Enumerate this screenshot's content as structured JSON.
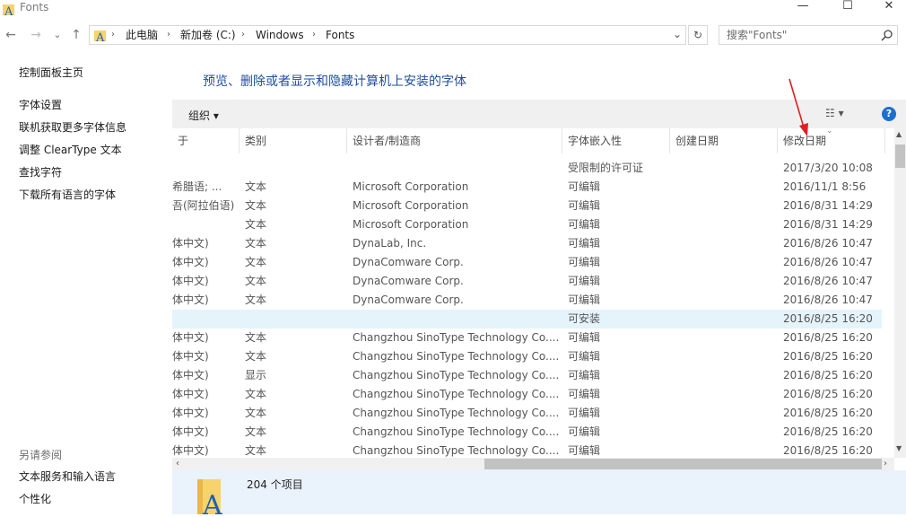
{
  "window": {
    "title": "Fonts",
    "controls": {
      "minimize": "—",
      "maximize": "☐",
      "close": "✕"
    }
  },
  "nav": {
    "back": "←",
    "forward": "→",
    "recent": "⌄",
    "up": "↑",
    "breadcrumbs": [
      "此电脑",
      "新加卷 (C:)",
      "Windows",
      "Fonts"
    ],
    "separator": "›",
    "dropdown": "⌄",
    "refresh": "↻",
    "search_placeholder": "搜索\"Fonts\"",
    "search_icon": "search-icon"
  },
  "left_pane": {
    "home": "控制面板主页",
    "links": [
      "字体设置",
      "联机获取更多字体信息",
      "调整 ClearType 文本",
      "查找字符",
      "下载所有语言的字体"
    ],
    "see_also_title": "另请参阅",
    "see_also": [
      "文本服务和输入语言",
      "个性化"
    ]
  },
  "main": {
    "heading": "预览、删除或者显示和隐藏计算机上安装的字体",
    "toolbar": {
      "organize": "组织 ▾",
      "view": "☷ ▾",
      "help": "?"
    },
    "columns": [
      "于",
      "类别",
      "设计者/制造商",
      "字体嵌入性",
      "创建日期",
      "修改日期"
    ],
    "rows": [
      {
        "lang": "",
        "category": "",
        "designer": "",
        "embed": "受限制的许可证",
        "created": "",
        "modified": "2017/3/20 10:08"
      },
      {
        "lang": "希腊语; ...",
        "category": "文本",
        "designer": "Microsoft Corporation",
        "embed": "可编辑",
        "created": "",
        "modified": "2016/11/1 8:56"
      },
      {
        "lang": "吾(阿拉伯语)",
        "category": "文本",
        "designer": "Microsoft Corporation",
        "embed": "可编辑",
        "created": "",
        "modified": "2016/8/31 14:29"
      },
      {
        "lang": "",
        "category": "文本",
        "designer": "Microsoft Corporation",
        "embed": "可编辑",
        "created": "",
        "modified": "2016/8/31 14:29"
      },
      {
        "lang": "体中文)",
        "category": "文本",
        "designer": "DynaLab, Inc.",
        "embed": "可编辑",
        "created": "",
        "modified": "2016/8/26 10:47"
      },
      {
        "lang": "体中文)",
        "category": "文本",
        "designer": "DynaComware Corp.",
        "embed": "可编辑",
        "created": "",
        "modified": "2016/8/26 10:47"
      },
      {
        "lang": "体中文)",
        "category": "文本",
        "designer": "DynaComware Corp.",
        "embed": "可编辑",
        "created": "",
        "modified": "2016/8/26 10:47"
      },
      {
        "lang": "体中文)",
        "category": "文本",
        "designer": "DynaComware Corp.",
        "embed": "可编辑",
        "created": "",
        "modified": "2016/8/26 10:47"
      },
      {
        "lang": "",
        "category": "",
        "designer": "",
        "embed": "可安装",
        "created": "",
        "modified": "2016/8/25 16:20",
        "selected": true
      },
      {
        "lang": "体中文)",
        "category": "文本",
        "designer": "Changzhou SinoType Technology Co....",
        "embed": "可编辑",
        "created": "",
        "modified": "2016/8/25 16:20"
      },
      {
        "lang": "体中文)",
        "category": "文本",
        "designer": "Changzhou SinoType Technology Co....",
        "embed": "可编辑",
        "created": "",
        "modified": "2016/8/25 16:20"
      },
      {
        "lang": "体中文)",
        "category": "显示",
        "designer": "Changzhou SinoType Technology Co....",
        "embed": "可编辑",
        "created": "",
        "modified": "2016/8/25 16:20"
      },
      {
        "lang": "体中文)",
        "category": "文本",
        "designer": "Changzhou SinoType Technology Co....",
        "embed": "可编辑",
        "created": "",
        "modified": "2016/8/25 16:20"
      },
      {
        "lang": "体中文)",
        "category": "文本",
        "designer": "Changzhou SinoType Technology Co....",
        "embed": "可编辑",
        "created": "",
        "modified": "2016/8/25 16:20"
      },
      {
        "lang": "体中文)",
        "category": "文本",
        "designer": "Changzhou SinoType Technology Co....",
        "embed": "可编辑",
        "created": "",
        "modified": "2016/8/25 16:20"
      },
      {
        "lang": "体中文)",
        "category": "文本",
        "designer": "Changzhou SinoType Technology Co....",
        "embed": "可编辑",
        "created": "",
        "modified": "2016/8/25 16:20"
      }
    ]
  },
  "details": {
    "count": "204 个项目"
  },
  "colors": {
    "heading": "#1e4e9e",
    "help": "#1c6fd1",
    "selected_row": "#e5f3fb",
    "annotation_arrow": "#e02020"
  }
}
